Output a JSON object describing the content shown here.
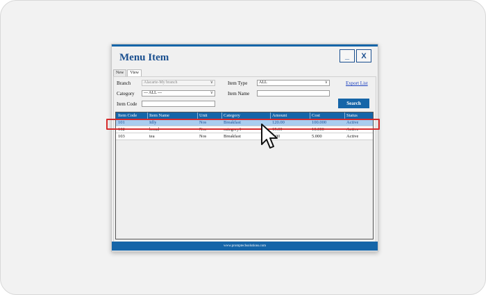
{
  "window": {
    "title": "Menu Item",
    "minimize_label": "_",
    "close_label": "X",
    "footer_text": "www.promptechsolutions.com"
  },
  "tabs": [
    {
      "label": "New",
      "active": false
    },
    {
      "label": "View",
      "active": true
    }
  ],
  "filters": {
    "branch_label": "Branch",
    "branch_value": "Alacarte-My branch",
    "category_label": "Category",
    "category_value": "--- ALL ---",
    "item_code_label": "Item Code",
    "item_code_value": "",
    "item_type_label": "Item Type",
    "item_type_value": "ALL",
    "item_name_label": "Item Name",
    "item_name_value": "",
    "export_link": "Export List",
    "search_button": "Search"
  },
  "table": {
    "columns": [
      "Item Code",
      "Item Name",
      "Unit",
      "Category",
      "Amount",
      "Cost",
      "Status"
    ],
    "rows": [
      {
        "code": "101",
        "name": "Idly",
        "unit": "Nos",
        "category": "Breakfast",
        "amount": "120.00",
        "cost": "100.000",
        "status": "Active",
        "selected": true
      },
      {
        "code": "102",
        "name": "bread",
        "unit": "Nos",
        "category": "category1",
        "amount": "15.00",
        "cost": "10.000",
        "status": "Active",
        "selected": false
      },
      {
        "code": "103",
        "name": "tea",
        "unit": "Nos",
        "category": "Breakfast",
        "amount": "5.00",
        "cost": "5.000",
        "status": "Active",
        "selected": false
      }
    ]
  },
  "colors": {
    "accent": "#1565a8",
    "selected_row": "#a9cdef",
    "highlight": "#d62b2b"
  },
  "icons": [
    "dropdown-caret-icon",
    "mouse-pointer-icon"
  ]
}
